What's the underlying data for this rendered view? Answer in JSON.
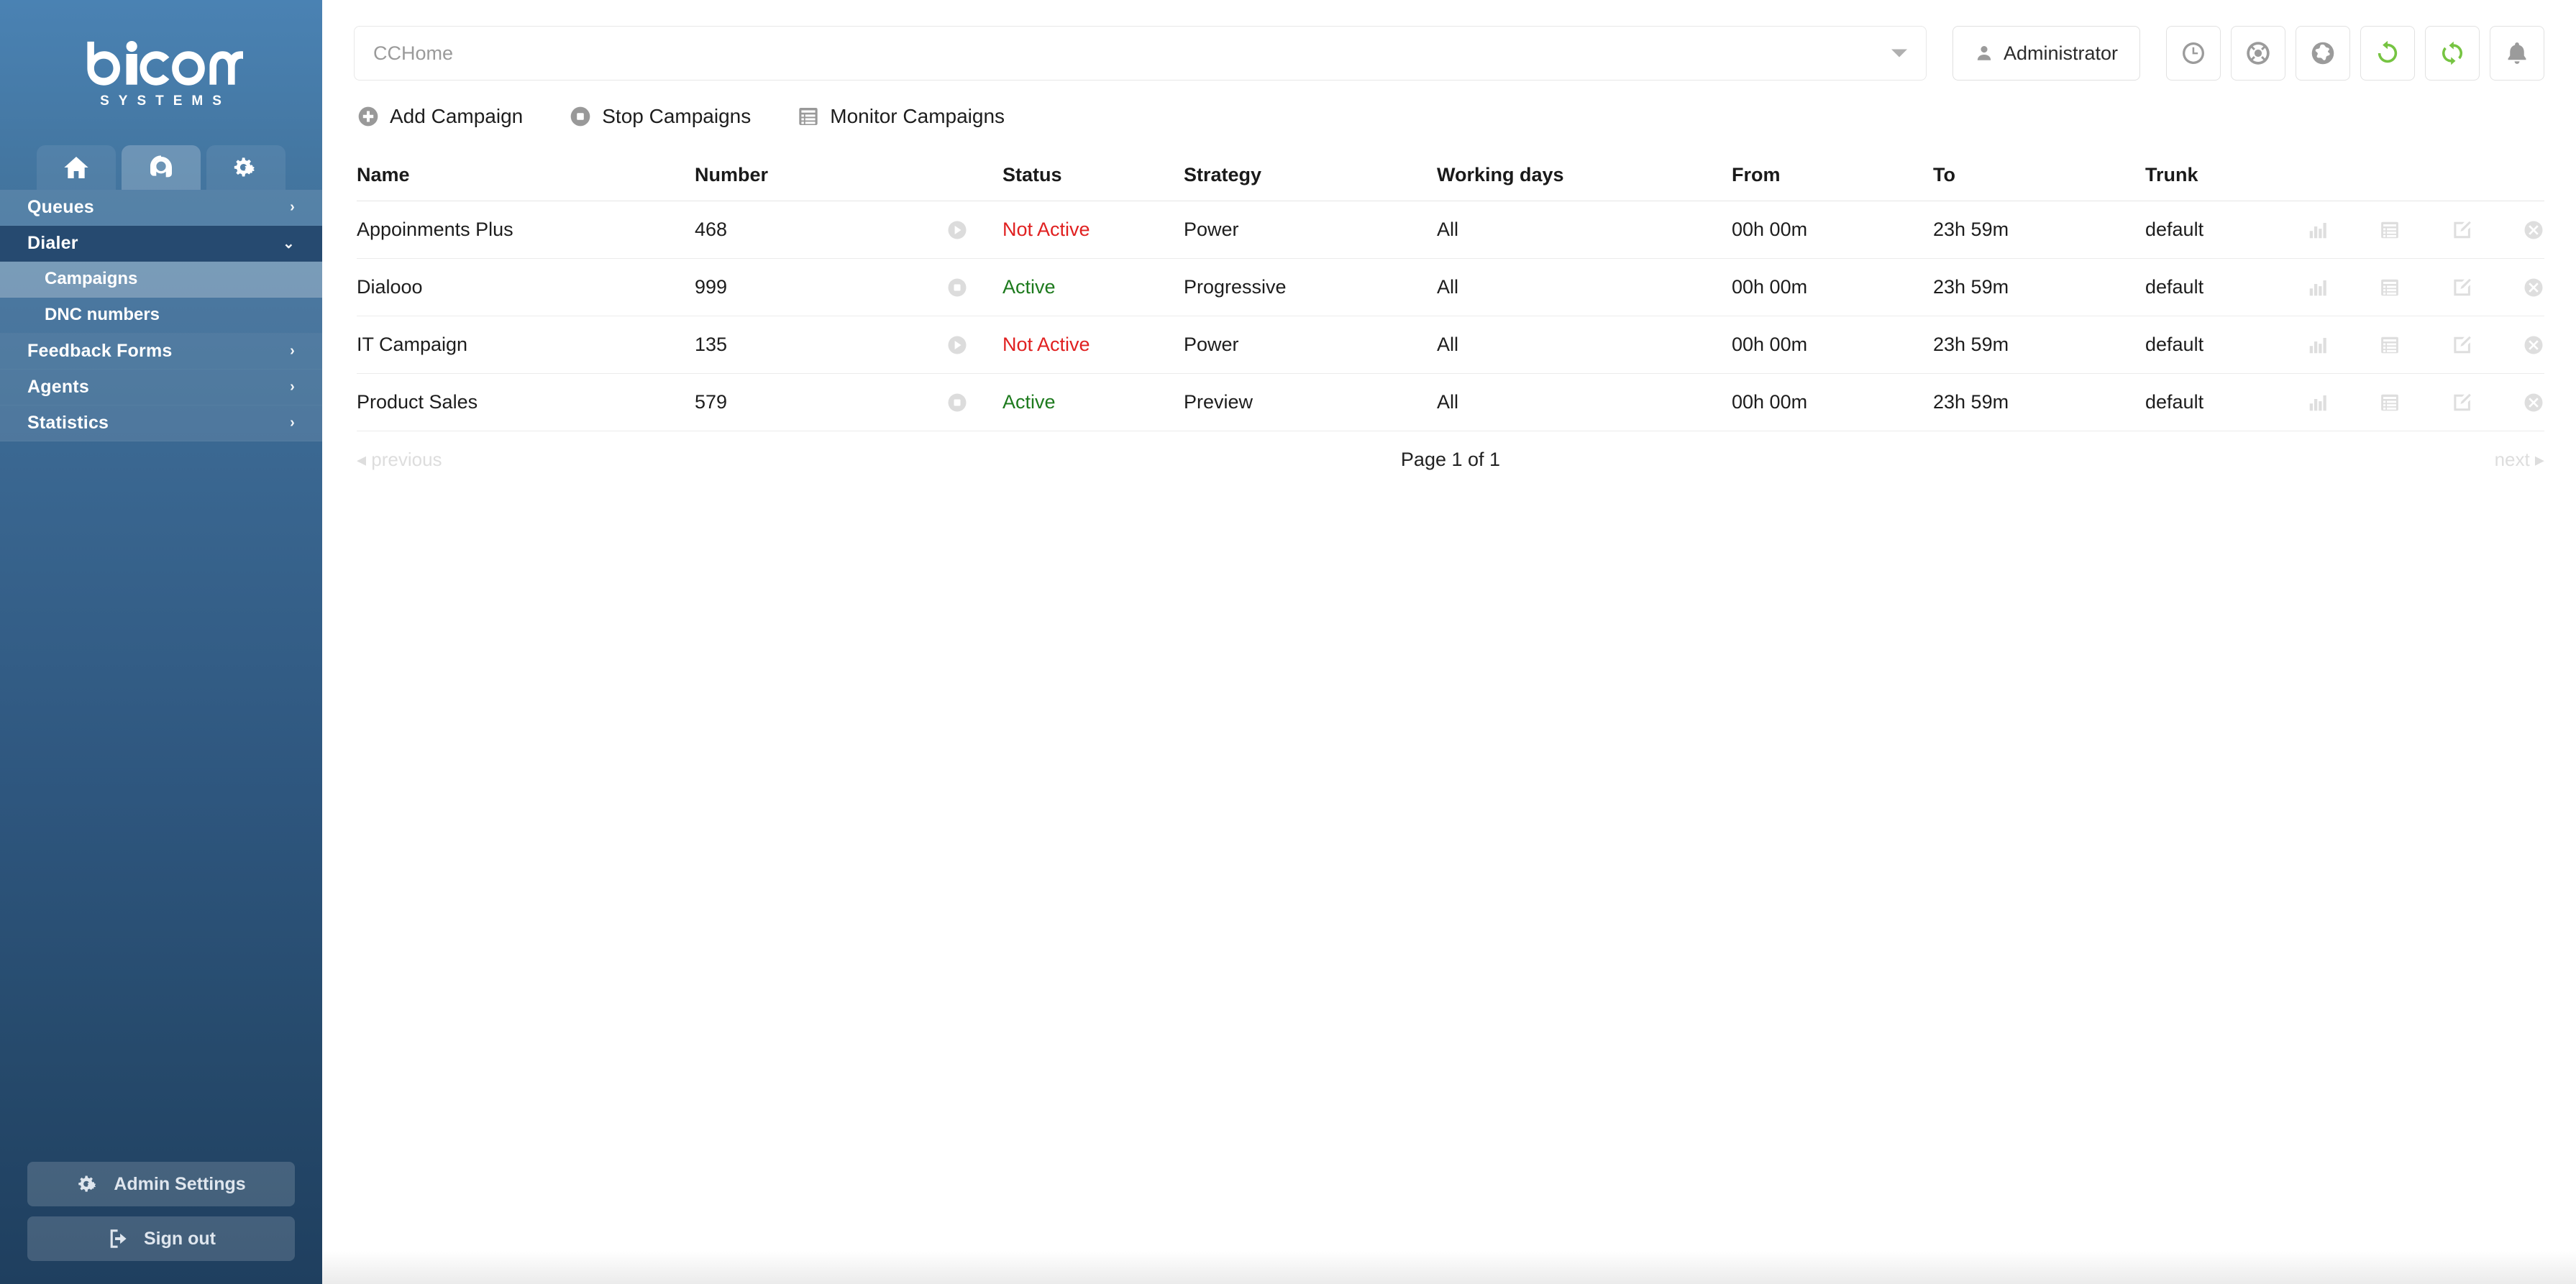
{
  "brand": {
    "name": "bicom",
    "tagline": "SYSTEMS",
    "accent": "#4a82b3"
  },
  "sidebar": {
    "tabs": [
      {
        "icon": "home-icon",
        "active": false
      },
      {
        "icon": "headset-icon",
        "active": true
      },
      {
        "icon": "gears-icon",
        "active": false
      }
    ],
    "nav": [
      {
        "label": "Queues",
        "chevron": "›",
        "state": "collapsed"
      },
      {
        "label": "Dialer",
        "chevron": "⌄",
        "state": "open"
      },
      {
        "label": "Feedback Forms",
        "chevron": "›",
        "state": "collapsed"
      },
      {
        "label": "Agents",
        "chevron": "›",
        "state": "collapsed"
      },
      {
        "label": "Statistics",
        "chevron": "›",
        "state": "collapsed"
      }
    ],
    "sub_items": [
      {
        "label": "Campaigns",
        "selected": true
      },
      {
        "label": "DNC numbers",
        "selected": false
      }
    ],
    "bottom_buttons": [
      {
        "label": "Admin Settings",
        "icon": "gears-icon"
      },
      {
        "label": "Sign out",
        "icon": "sign-out-icon"
      }
    ]
  },
  "topbar": {
    "selector_value": "CCHome",
    "user_label": "Administrator",
    "icons": [
      {
        "name": "clock-icon",
        "color": "#9b9b9b"
      },
      {
        "name": "life-ring-icon",
        "color": "#9b9b9b"
      },
      {
        "name": "globe-icon",
        "color": "#9b9b9b"
      },
      {
        "name": "refresh-icon",
        "color": "#76c442"
      },
      {
        "name": "sync-icon",
        "color": "#76c442"
      },
      {
        "name": "bell-icon",
        "color": "#9b9b9b"
      }
    ]
  },
  "actionbar": [
    {
      "label": "Add Campaign",
      "icon": "plus-circle-icon"
    },
    {
      "label": "Stop Campaigns",
      "icon": "stop-circle-icon"
    },
    {
      "label": "Monitor Campaigns",
      "icon": "list-icon"
    }
  ],
  "table": {
    "columns": [
      "Name",
      "Number",
      "Status",
      "Strategy",
      "Working days",
      "From",
      "To",
      "Trunk"
    ],
    "rows": [
      {
        "name": "Appoinments Plus",
        "number": "468",
        "toggle": "play-circle-icon",
        "status": "Not Active",
        "status_state": "inactive",
        "strategy": "Power",
        "working_days": "All",
        "from": "00h 00m",
        "to": "23h 59m",
        "trunk": "default"
      },
      {
        "name": "Dialooo",
        "number": "999",
        "toggle": "stop-circle-icon",
        "status": "Active",
        "status_state": "active",
        "strategy": "Progressive",
        "working_days": "All",
        "from": "00h 00m",
        "to": "23h 59m",
        "trunk": "default"
      },
      {
        "name": "IT Campaign",
        "number": "135",
        "toggle": "play-circle-icon",
        "status": "Not Active",
        "status_state": "inactive",
        "strategy": "Power",
        "working_days": "All",
        "from": "00h 00m",
        "to": "23h 59m",
        "trunk": "default"
      },
      {
        "name": "Product Sales",
        "number": "579",
        "toggle": "stop-circle-icon",
        "status": "Active",
        "status_state": "active",
        "strategy": "Preview",
        "working_days": "All",
        "from": "00h 00m",
        "to": "23h 59m",
        "trunk": "default"
      }
    ],
    "row_actions": [
      "bar-chart-icon",
      "list-icon",
      "edit-icon",
      "delete-icon"
    ]
  },
  "pagination": {
    "previous": "◂ previous",
    "page_info": "Page 1 of 1",
    "next": "next ▸"
  },
  "status_colors": {
    "active": "#1d7a1d",
    "inactive": "#e02020"
  }
}
